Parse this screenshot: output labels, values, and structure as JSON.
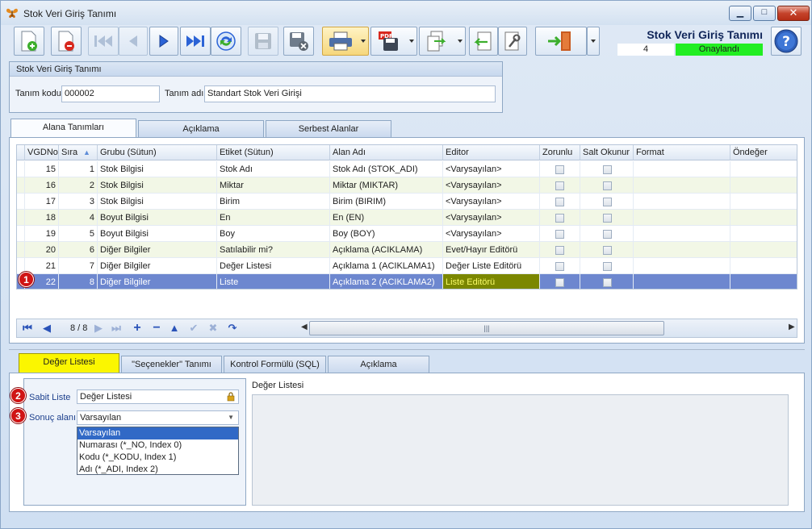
{
  "window": {
    "title": "Stok Veri Giriş Tanımı"
  },
  "header": {
    "title": "Stok Veri Giriş Tanımı",
    "record_number": "4",
    "status": "Onaylandı",
    "status_color": "#22ee22"
  },
  "definition": {
    "group_title": "Stok Veri Giriş Tanımı",
    "code_label": "Tanım kodu",
    "code_value": "000002",
    "name_label": "Tanım adı",
    "name_value": "Standart Stok Veri Girişi"
  },
  "top_tabs": [
    "Alana Tanımları",
    "Açıklama",
    "Serbest Alanlar"
  ],
  "grid": {
    "columns": [
      "VGDNo",
      "Sıra",
      "Grubu (Sütun)",
      "Etiket (Sütun)",
      "Alan Adı",
      "Editor",
      "Zorunlu",
      "Salt Okunur",
      "Format",
      "Öndeğer"
    ],
    "rows": [
      {
        "vgdno": "15",
        "sira": "1",
        "grup": "Stok Bilgisi",
        "etiket": "Stok Adı",
        "alan": "Stok Adı (STOK_ADI)",
        "editor": "<Varysayılan>"
      },
      {
        "vgdno": "16",
        "sira": "2",
        "grup": "Stok Bilgisi",
        "etiket": "Miktar",
        "alan": "Miktar (MIKTAR)",
        "editor": "<Varysayılan>"
      },
      {
        "vgdno": "17",
        "sira": "3",
        "grup": "Stok Bilgisi",
        "etiket": "Birim",
        "alan": "Birim (BIRIM)",
        "editor": "<Varysayılan>"
      },
      {
        "vgdno": "18",
        "sira": "4",
        "grup": "Boyut Bilgisi",
        "etiket": "En",
        "alan": "En (EN)",
        "editor": "<Varysayılan>"
      },
      {
        "vgdno": "19",
        "sira": "5",
        "grup": "Boyut Bilgisi",
        "etiket": "Boy",
        "alan": "Boy (BOY)",
        "editor": "<Varysayılan>"
      },
      {
        "vgdno": "20",
        "sira": "6",
        "grup": "Diğer Bilgiler",
        "etiket": "Satılabilir mi?",
        "alan": "Açıklama (ACIKLAMA)",
        "editor": "Evet/Hayır Editörü"
      },
      {
        "vgdno": "21",
        "sira": "7",
        "grup": "Diğer Bilgiler",
        "etiket": "Değer Listesi",
        "alan": "Açıklama 1 (ACIKLAMA1)",
        "editor": "Değer Liste Editörü"
      },
      {
        "vgdno": "22",
        "sira": "8",
        "grup": "Diğer Bilgiler",
        "etiket": "Liste",
        "alan": "Açıklama 2 (ACIKLAMA2)",
        "editor": "Liste Editörü"
      }
    ],
    "selected_index": 7
  },
  "navigator": {
    "position": "8 / 8"
  },
  "badges": [
    "1",
    "2",
    "3"
  ],
  "bottom_tabs": [
    "Değer Listesi",
    "\"Seçenekler\" Tanımı",
    "Kontrol Formülü (SQL)",
    "Açıklama"
  ],
  "value_list": {
    "fixed_list_label": "Sabit Liste",
    "fixed_list_value": "Değer Listesi",
    "result_field_label": "Sonuç alanı",
    "result_field_value": "Varsayılan",
    "options": [
      "Varsayılan",
      "Numarası (*_NO, Index 0)",
      "Kodu (*_KODU, Index 1)",
      "Adı (*_ADI, Index 2)"
    ],
    "right_panel_label": "Değer Listesi"
  }
}
